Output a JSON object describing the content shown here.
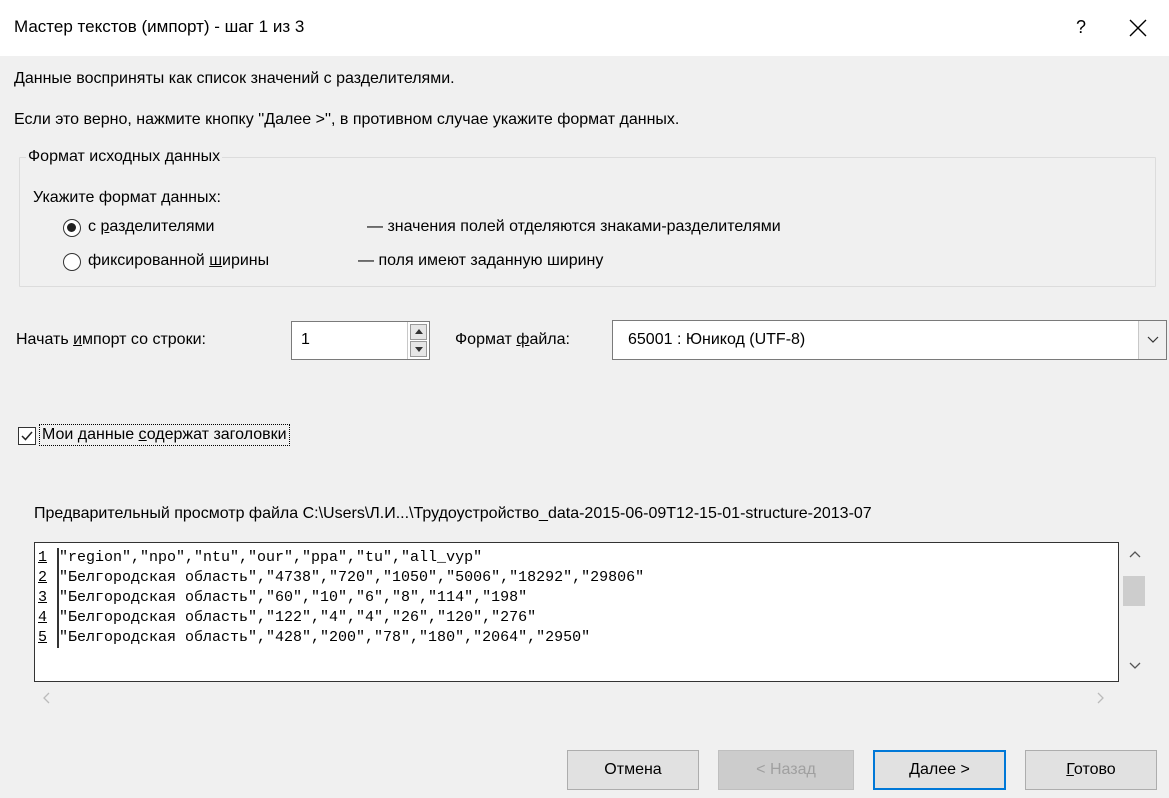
{
  "window": {
    "title": "Мастер текстов (импорт) - шаг 1 из 3",
    "help": "?",
    "close": "✕"
  },
  "intro": {
    "line1": "Данные восприняты как список значений с разделителями.",
    "line2": "Если это верно, нажмите кнопку ''Далее >'', в противном случае укажите формат данных."
  },
  "format_group": {
    "legend": "Формат исходных данных",
    "prompt": "Укажите формат данных:",
    "options": [
      {
        "label_pre": "с ",
        "label_u": "р",
        "label_post": "азделителями",
        "desc": "— значения полей отделяются знаками-разделителями",
        "selected": true
      },
      {
        "label_pre": "фиксированной ",
        "label_u": "ш",
        "label_post": "ирины",
        "desc": "— поля имеют заданную ширину",
        "selected": false
      }
    ]
  },
  "start_row": {
    "label_pre": "Начать ",
    "label_u": "и",
    "label_post": "мпорт со строки:",
    "value": "1"
  },
  "file_format": {
    "label_pre": "Формат ",
    "label_u": "ф",
    "label_post": "айла:",
    "value": "65001 : Юникод (UTF-8)"
  },
  "headers_checkbox": {
    "label_pre": "Мои данные ",
    "label_u": "с",
    "label_post": "одержат заголовки",
    "checked": true
  },
  "preview": {
    "caption": "Предварительный просмотр файла C:\\Users\\Л.И...\\Трудоустройство_data-2015-06-09T12-15-01-structure-2013-07",
    "lines": [
      {
        "n": "1",
        "text": "\"region\",\"npo\",\"ntu\",\"our\",\"ppa\",\"tu\",\"all_vyp\""
      },
      {
        "n": "2",
        "text": "\"Белгородская область\",\"4738\",\"720\",\"1050\",\"5006\",\"18292\",\"29806\""
      },
      {
        "n": "3",
        "text": "\"Белгородская область\",\"60\",\"10\",\"6\",\"8\",\"114\",\"198\""
      },
      {
        "n": "4",
        "text": "\"Белгородская область\",\"122\",\"4\",\"4\",\"26\",\"120\",\"276\""
      },
      {
        "n": "5",
        "text": "\"Белгородская область\",\"428\",\"200\",\"78\",\"180\",\"2064\",\"2950\""
      }
    ]
  },
  "buttons": {
    "cancel": "Отмена",
    "back": "< Назад",
    "next_u": "Д",
    "next_post": "алее >",
    "finish_u": "Г",
    "finish_post": "отово"
  },
  "colors": {
    "accent": "#0078d7",
    "window_bg": "#f0f0f0"
  }
}
